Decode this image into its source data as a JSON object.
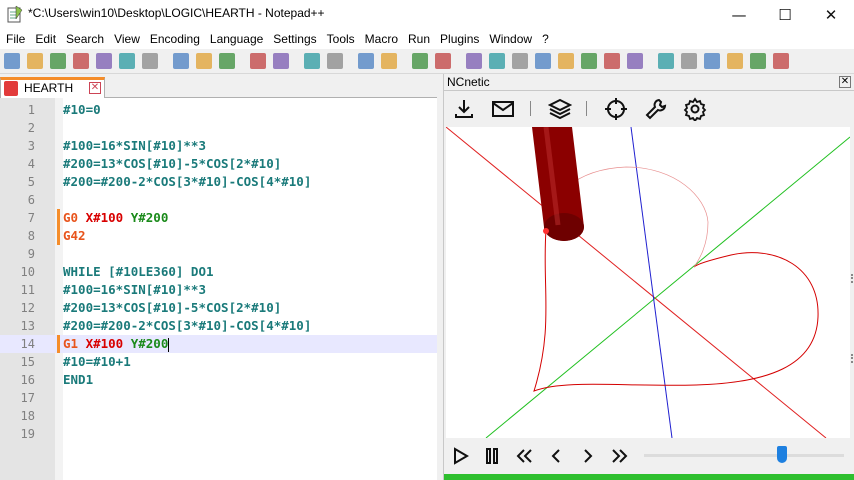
{
  "window": {
    "title": "*C:\\Users\\win10\\Desktop\\LOGIC\\HEARTH - Notepad++",
    "controls": {
      "minimize": "—",
      "maximize": "☐",
      "close": "✕"
    }
  },
  "menu": [
    "File",
    "Edit",
    "Search",
    "View",
    "Encoding",
    "Language",
    "Settings",
    "Tools",
    "Macro",
    "Run",
    "Plugins",
    "Window",
    "?"
  ],
  "toolbar_icons": [
    "new-file-icon",
    "open-file-icon",
    "save-icon",
    "save-all-icon",
    "close-icon",
    "close-all-icon",
    "print-icon",
    "cut-icon",
    "copy-icon",
    "paste-icon",
    "undo-icon",
    "redo-icon",
    "find-icon",
    "replace-icon",
    "zoom-in-icon",
    "zoom-out-icon",
    "sync-v-icon",
    "sync-h-icon",
    "word-wrap-icon",
    "all-chars-icon",
    "indent-guide-icon",
    "udl-icon",
    "doc-map-icon",
    "function-list-icon",
    "folder-workspace-icon",
    "monitor-icon",
    "record-macro-icon",
    "stop-macro-icon",
    "play-macro-icon",
    "run-macro-icon",
    "save-macro-icon",
    "plugin-icon"
  ],
  "tab": {
    "label": "HEARTH",
    "close": "✕"
  },
  "editor": {
    "lines": [
      {
        "n": "1",
        "parts": [
          {
            "t": "#10=0",
            "c": "c-t"
          }
        ]
      },
      {
        "n": "2",
        "parts": []
      },
      {
        "n": "3",
        "parts": [
          {
            "t": "#100=16*SIN[#10]**3",
            "c": "c-t"
          }
        ]
      },
      {
        "n": "4",
        "parts": [
          {
            "t": "#200=13*COS[#10]-5*COS[2*#10]",
            "c": "c-t"
          }
        ]
      },
      {
        "n": "5",
        "parts": [
          {
            "t": "#200=#200-2*COS[3*#10]-COS[4*#10]",
            "c": "c-t"
          }
        ]
      },
      {
        "n": "6",
        "parts": []
      },
      {
        "n": "7",
        "changed": true,
        "parts": [
          {
            "t": "G0 ",
            "c": "c-g"
          },
          {
            "t": "X#100 ",
            "c": "c-x"
          },
          {
            "t": "Y#200",
            "c": "c-y"
          }
        ]
      },
      {
        "n": "8",
        "changed": true,
        "parts": [
          {
            "t": "G42",
            "c": "c-g"
          }
        ]
      },
      {
        "n": "9",
        "parts": []
      },
      {
        "n": "10",
        "parts": [
          {
            "t": "WHILE [#10LE360] DO1",
            "c": "c-t"
          }
        ]
      },
      {
        "n": "11",
        "parts": [
          {
            "t": "#100=16*SIN[#10]**3",
            "c": "c-t"
          }
        ]
      },
      {
        "n": "12",
        "parts": [
          {
            "t": "#200=13*COS[#10]-5*COS[2*#10]",
            "c": "c-t"
          }
        ]
      },
      {
        "n": "13",
        "parts": [
          {
            "t": "#200=#200-2*COS[3*#10]-COS[4*#10]",
            "c": "c-t"
          }
        ]
      },
      {
        "n": "14",
        "changed": true,
        "current": true,
        "caret": true,
        "parts": [
          {
            "t": "G1 ",
            "c": "c-g"
          },
          {
            "t": "X#100 ",
            "c": "c-x"
          },
          {
            "t": "Y#200",
            "c": "c-y"
          }
        ]
      },
      {
        "n": "15",
        "parts": [
          {
            "t": "#10=#10+1",
            "c": "c-t"
          }
        ]
      },
      {
        "n": "16",
        "parts": [
          {
            "t": "END1",
            "c": "c-t"
          }
        ]
      },
      {
        "n": "17",
        "parts": []
      },
      {
        "n": "18",
        "parts": []
      },
      {
        "n": "19",
        "parts": []
      }
    ]
  },
  "ncnetic": {
    "title": "NCnetic",
    "close": "✕",
    "tools": [
      "download-icon",
      "mail-icon",
      "layers-icon",
      "target-icon",
      "wrench-icon",
      "gear-icon"
    ],
    "playback": [
      "play-icon",
      "pause-icon",
      "rewind-icon",
      "step-back-icon",
      "step-forward-icon",
      "fast-forward-icon"
    ],
    "slider_fraction": 0.69,
    "colors": {
      "toolpath": "#d40000",
      "axis_x": "#e02020",
      "axis_y": "#20c020",
      "axis_z": "#2020d0",
      "tool": "#8b0000",
      "progress": "#2ebf2e"
    }
  }
}
